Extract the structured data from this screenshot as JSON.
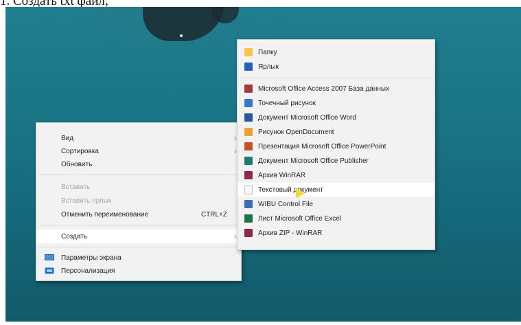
{
  "doc": {
    "heading": "1. Создать txt файл;"
  },
  "context_menu": {
    "items": [
      {
        "label": "Вид",
        "submenu": true,
        "disabled": false
      },
      {
        "label": "Сортировка",
        "submenu": true,
        "disabled": false
      },
      {
        "label": "Обновить",
        "submenu": false,
        "disabled": false
      },
      {
        "label": "Вставить",
        "submenu": false,
        "disabled": true
      },
      {
        "label": "Вставить ярлык",
        "submenu": false,
        "disabled": true
      },
      {
        "label": "Отменить переименование",
        "shortcut": "CTRL+Z",
        "submenu": false,
        "disabled": false
      },
      {
        "label": "Создать",
        "submenu": true,
        "disabled": false,
        "highlighted": true
      },
      {
        "label": "Параметры экрана",
        "icon": "display-icon"
      },
      {
        "label": "Персонализация",
        "icon": "personalize-icon"
      }
    ]
  },
  "new_submenu": {
    "items": [
      {
        "label": "Папку",
        "icon": "folder-icon",
        "color": "#f3c54b"
      },
      {
        "label": "Ярлык",
        "icon": "shortcut-icon",
        "color": "#2a5fb8"
      },
      {
        "label": "Microsoft Office Access 2007 База данных",
        "icon": "access-icon",
        "color": "#a83a3a"
      },
      {
        "label": "Точечный рисунок",
        "icon": "bitmap-icon",
        "color": "#3a78c8"
      },
      {
        "label": "Документ Microsoft Office Word",
        "icon": "word-icon",
        "color": "#2b579a"
      },
      {
        "label": "Рисунок OpenDocument",
        "icon": "opendocument-icon",
        "color": "#e8a23a"
      },
      {
        "label": "Презентация Microsoft Office PowerPoint",
        "icon": "powerpoint-icon",
        "color": "#c4512a"
      },
      {
        "label": "Документ Microsoft Office Publisher",
        "icon": "publisher-icon",
        "color": "#1f7b6e"
      },
      {
        "label": "Архив WinRAR",
        "icon": "winrar-icon",
        "color": "#8b2a4e"
      },
      {
        "label": "Текстовый документ",
        "icon": "text-document-icon",
        "color": "#f8f8f8",
        "highlighted": true
      },
      {
        "label": "WIBU Control File",
        "icon": "wibu-icon",
        "color": "#3a6fb0"
      },
      {
        "label": "Лист Microsoft Office Excel",
        "icon": "excel-icon",
        "color": "#207245"
      },
      {
        "label": "Архив ZIP - WinRAR",
        "icon": "zip-icon",
        "color": "#8b2a4e"
      }
    ]
  }
}
